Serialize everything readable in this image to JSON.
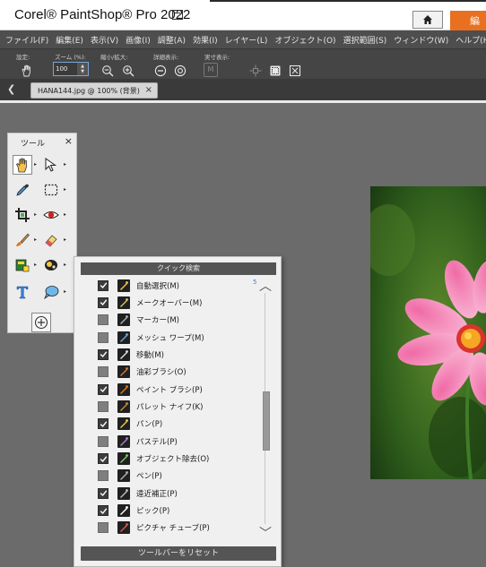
{
  "app": {
    "title": "Corel® PaintShop® Pro 2022",
    "orange_button": "編"
  },
  "menu": [
    "ファイル(F)",
    "編集(E)",
    "表示(V)",
    "画像(I)",
    "調整(A)",
    "効果(I)",
    "レイヤー(L)",
    "オブジェクト(O)",
    "選択範囲(S)",
    "ウィンドウ(W)",
    "ヘルプ(H)"
  ],
  "options": {
    "presets_label": "設定:",
    "zoom_label": "ズーム (%):",
    "zoom_value": "100",
    "zoom_inout_label": "縮小/拡大:",
    "actual_label": "詳細表示:",
    "actual_size_label": "実寸表示:"
  },
  "tab": {
    "title": "HANA144.jpg @ 100% (背景)",
    "close": "×"
  },
  "tools_panel": {
    "title": "ツール",
    "close": "×"
  },
  "quick_search": {
    "title": "クイック検索",
    "marker": "5",
    "items": [
      {
        "label": "自動選択(M)",
        "checked": true,
        "icon": "magic-wand-icon"
      },
      {
        "label": "メークオーバー(M)",
        "checked": true,
        "icon": "makeover-icon"
      },
      {
        "label": "マーカー(M)",
        "checked": false,
        "icon": "marker-icon"
      },
      {
        "label": "メッシュ ワープ(M)",
        "checked": false,
        "icon": "mesh-warp-icon"
      },
      {
        "label": "移動(M)",
        "checked": true,
        "icon": "move-icon"
      },
      {
        "label": "油彩ブラシ(O)",
        "checked": false,
        "icon": "oil-brush-icon"
      },
      {
        "label": "ペイント ブラシ(P)",
        "checked": true,
        "icon": "paint-brush-icon"
      },
      {
        "label": "パレット ナイフ(K)",
        "checked": false,
        "icon": "palette-knife-icon"
      },
      {
        "label": "パン(P)",
        "checked": true,
        "icon": "pan-icon"
      },
      {
        "label": "パステル(P)",
        "checked": false,
        "icon": "pastel-icon"
      },
      {
        "label": "オブジェクト除去(O)",
        "checked": true,
        "icon": "object-remover-icon"
      },
      {
        "label": "ペン(P)",
        "checked": false,
        "icon": "pen-icon"
      },
      {
        "label": "遠近補正(P)",
        "checked": true,
        "icon": "perspective-icon"
      },
      {
        "label": "ピック(P)",
        "checked": true,
        "icon": "pick-icon"
      },
      {
        "label": "ピクチャ チューブ(P)",
        "checked": false,
        "icon": "picture-tube-icon"
      }
    ],
    "reset_label": "ツールバーをリセット"
  },
  "colors": {
    "accent": "#e87020",
    "canvas": "#6b6b6b",
    "menubar": "#4e4e4e",
    "panel": "#ececec"
  }
}
